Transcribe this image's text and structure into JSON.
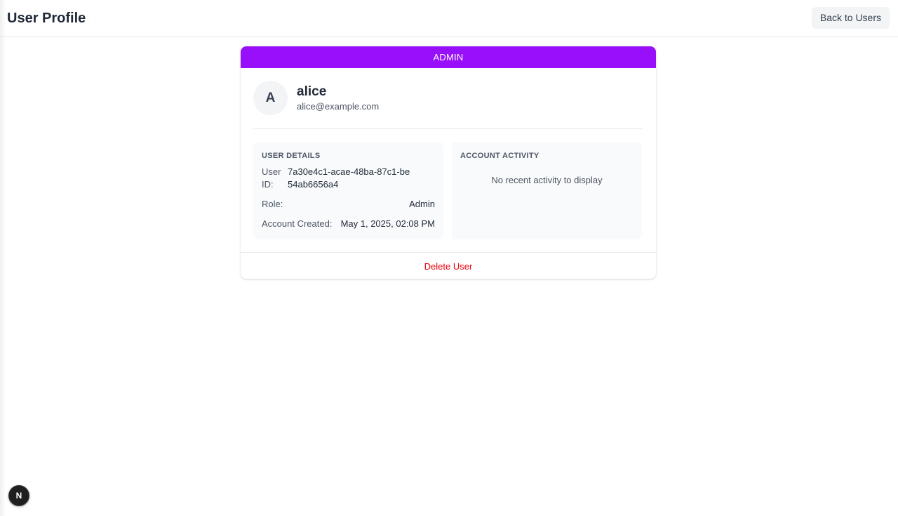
{
  "header": {
    "title": "User Profile",
    "back_label": "Back to Users"
  },
  "card": {
    "role_badge": "ADMIN",
    "role_badge_color": "#9810fa",
    "avatar_initial": "A",
    "username": "alice",
    "email": "alice@example.com",
    "details": {
      "heading": "USER DETAILS",
      "user_id_label": "User ID:",
      "user_id_value": "7a30e4c1-acae-48ba-87c1-be54ab6656a4",
      "role_label": "Role:",
      "role_value": "Admin",
      "created_label": "Account Created:",
      "created_value": "May 1, 2025, 02:08 PM"
    },
    "activity": {
      "heading": "ACCOUNT ACTIVITY",
      "empty_message": "No recent activity to display"
    },
    "delete_label": "Delete User",
    "delete_color": "#e7000b"
  },
  "dev_badge": {
    "letter": "N",
    "icon": "nextjs-logo-icon"
  }
}
